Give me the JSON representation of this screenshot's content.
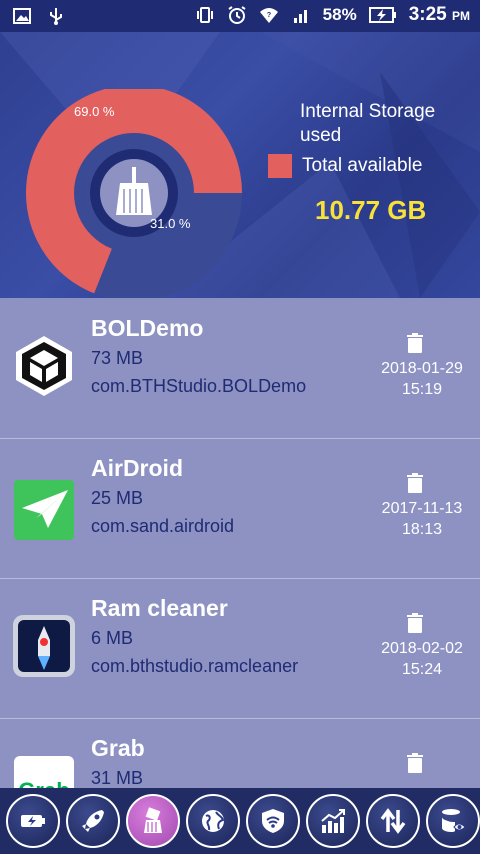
{
  "status_bar": {
    "battery_percent": "58%",
    "time": "3:25",
    "ampm": "PM"
  },
  "storage": {
    "used_percent_label": "69.0 %",
    "free_percent_label": "31.0 %",
    "used_fraction": 0.69,
    "legend_used": "Internal Storage used",
    "legend_available": "Total available",
    "total_available": "10.77 GB",
    "used_color": "#e2615f",
    "free_color": "#3a4a94"
  },
  "apps": [
    {
      "name": "BOLDemo",
      "size": "73 MB",
      "package": "com.BTHStudio.BOLDemo",
      "date": "2018-01-29",
      "time": "15:19",
      "icon": "unity-icon"
    },
    {
      "name": "AirDroid",
      "size": "25 MB",
      "package": "com.sand.airdroid",
      "date": "2017-11-13",
      "time": "18:13",
      "icon": "airdroid-icon"
    },
    {
      "name": "Ram cleaner",
      "size": "6 MB",
      "package": "com.bthstudio.ramcleaner",
      "date": "2018-02-02",
      "time": "15:24",
      "icon": "ram-cleaner-icon"
    },
    {
      "name": "Grab",
      "size": "31 MB",
      "package": "",
      "date": "",
      "time": "",
      "icon": "grab-icon"
    }
  ],
  "bottom_nav": [
    {
      "icon": "battery-icon",
      "active": false
    },
    {
      "icon": "rocket-icon",
      "active": false
    },
    {
      "icon": "broom-icon",
      "active": true
    },
    {
      "icon": "globe-icon",
      "active": false
    },
    {
      "icon": "wifi-shield-icon",
      "active": false
    },
    {
      "icon": "chart-icon",
      "active": false
    },
    {
      "icon": "transfer-icon",
      "active": false
    },
    {
      "icon": "storage-eye-icon",
      "active": false
    }
  ]
}
